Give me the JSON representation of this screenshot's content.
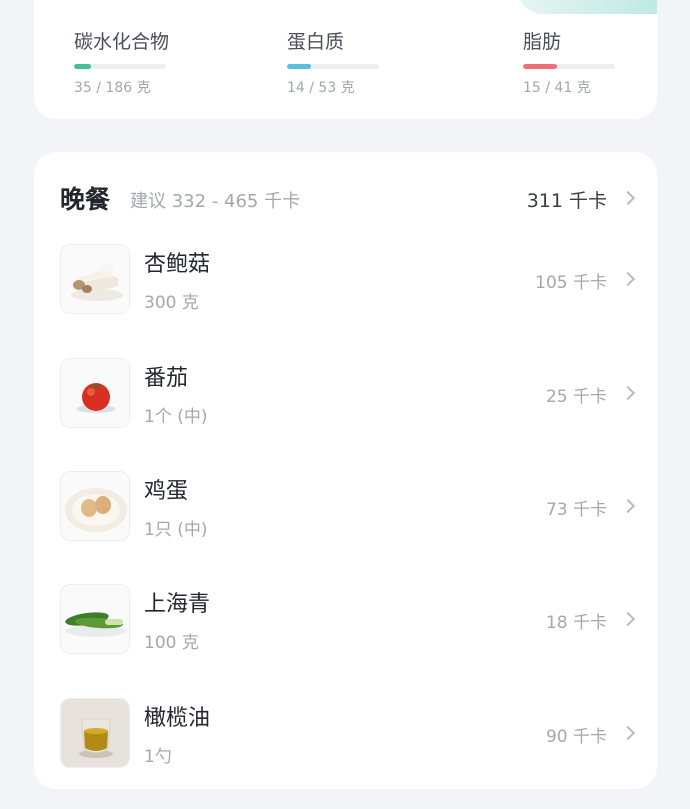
{
  "macros": [
    {
      "name": "碳水化合物",
      "value": "35 / 186 克",
      "fraction": 0.19,
      "color": "#3fc38f"
    },
    {
      "name": "蛋白质",
      "value": "14 / 53 克",
      "fraction": 0.26,
      "color": "#58bfe0"
    },
    {
      "name": "脂肪",
      "value": "15 / 41 克",
      "fraction": 0.37,
      "color": "#ef6f77"
    }
  ],
  "meal": {
    "title": "晚餐",
    "suggestion": "建议 332 - 465 千卡",
    "total": "311 千卡",
    "foods": [
      {
        "name": "杏鲍菇",
        "amount": "300 克",
        "kcal": "105 千卡",
        "icon": "king-oyster-mushroom-icon"
      },
      {
        "name": "番茄",
        "amount": "1个 (中)",
        "kcal": "25 千卡",
        "icon": "tomato-icon"
      },
      {
        "name": "鸡蛋",
        "amount": "1只 (中)",
        "kcal": "73 千卡",
        "icon": "egg-icon"
      },
      {
        "name": "上海青",
        "amount": "100 克",
        "kcal": "18 千卡",
        "icon": "bok-choy-icon"
      },
      {
        "name": "橄榄油",
        "amount": "1勺",
        "kcal": "90 千卡",
        "icon": "olive-oil-icon"
      }
    ]
  }
}
